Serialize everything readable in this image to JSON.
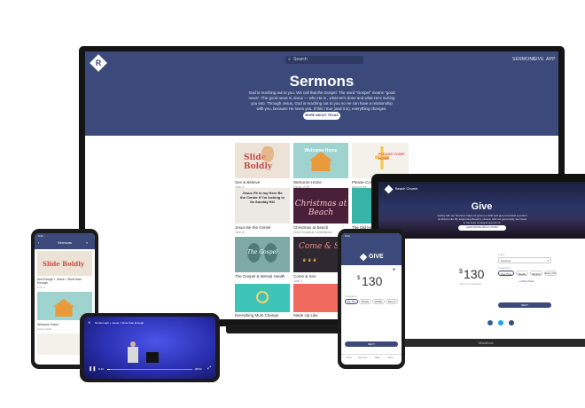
{
  "monitor": {
    "search_placeholder": "Search",
    "nav": [
      "SERMONS",
      "GIVE",
      "APP"
    ],
    "hero": {
      "title": "Sermons",
      "body": "God is reaching out to you. We call that the Gospel. The word \"Gospel\" means \"good news\". The good news is Jesus — who He is , what He's done and what He's inviting you into. Through Jesus, God is reaching out to you so He can have a relationship with you, because He loves you. If this I true (and it is), everything changes.",
      "button": "MORE ABOUT TEXAS"
    },
    "cards": [
      {
        "art": "Slide Boldly",
        "title": "See & Believe",
        "sub": "John 4"
      },
      {
        "art": "Welcome Home",
        "title": "Welcome Home",
        "sub": "Easter 2018"
      },
      {
        "art": "PLEASE COME HOME",
        "title": "Please Come Home",
        "sub": "Around the"
      },
      {
        "art": "Jesus Fit in my Here Be the Center If I'm locking in Its Sunday Hill",
        "title": "Jesus Be the Center",
        "sub": "John 5"
      },
      {
        "art": "Christmas at Beach",
        "title": "Christmas at Beach",
        "sub": "2018 Christmas Celebrations"
      },
      {
        "art": "",
        "title": "The Old Ha Come",
        "sub": ""
      },
      {
        "art": "The Gospel",
        "title": "The Gospel & Mental Health",
        "sub": ""
      },
      {
        "art": "Come & See",
        "title": "Come & See",
        "sub": "John 1"
      },
      {
        "art": "",
        "title": "",
        "sub": ""
      },
      {
        "art": "",
        "title": "Everything Must Change",
        "sub": ""
      },
      {
        "art": "",
        "title": "Made Up Like",
        "sub": ""
      }
    ]
  },
  "laptop": {
    "church_name": "Beach Church",
    "title": "Give",
    "body": "Giving with our finances helps us grow our faith and give God back a portion of what is His. By supporting Beach's mission with our generosity, we invest in the lives of people around us.",
    "button": "LEARN MORE ABOUT GIVING",
    "amount_currency": "$",
    "amount": "130",
    "amount_note": "One time donation",
    "fund_label": "Fund",
    "fund_value": "General",
    "frequency_label": "Frequency",
    "frequencies": [
      "One Time",
      "Weekly",
      "Monthly",
      "Every 2 Weeks"
    ],
    "add_note": "+ Add a Note",
    "submit": "NEXT",
    "brand": "MacBook"
  },
  "phone_left": {
    "time": "9:41",
    "title": "Sermons",
    "items": [
      {
        "title": "Not Enough + Jesus = More than Enough",
        "sub": "Luke 9"
      },
      {
        "title": "Welcome Home",
        "sub": "Easter 2018"
      }
    ]
  },
  "phone_video": {
    "title": "Not Enough + Jesus = More than Enough",
    "time_elapsed": "0:12",
    "time_total": "-38:02"
  },
  "phone_right": {
    "time": "9:41",
    "title": "GIVE",
    "amount_currency": "$",
    "amount": "130",
    "frequency_label": "Frequency",
    "frequencies": [
      "One Time",
      "Weekly",
      "Monthly",
      "Every 2"
    ],
    "submit": "NEXT",
    "tabs": [
      "Home",
      "Sermons",
      "Give",
      "More"
    ]
  },
  "colors": {
    "navy": "#3b4a7a",
    "navy_dark": "#2d3a62",
    "coral": "#f06b5e",
    "teal": "#3cc0b6"
  }
}
